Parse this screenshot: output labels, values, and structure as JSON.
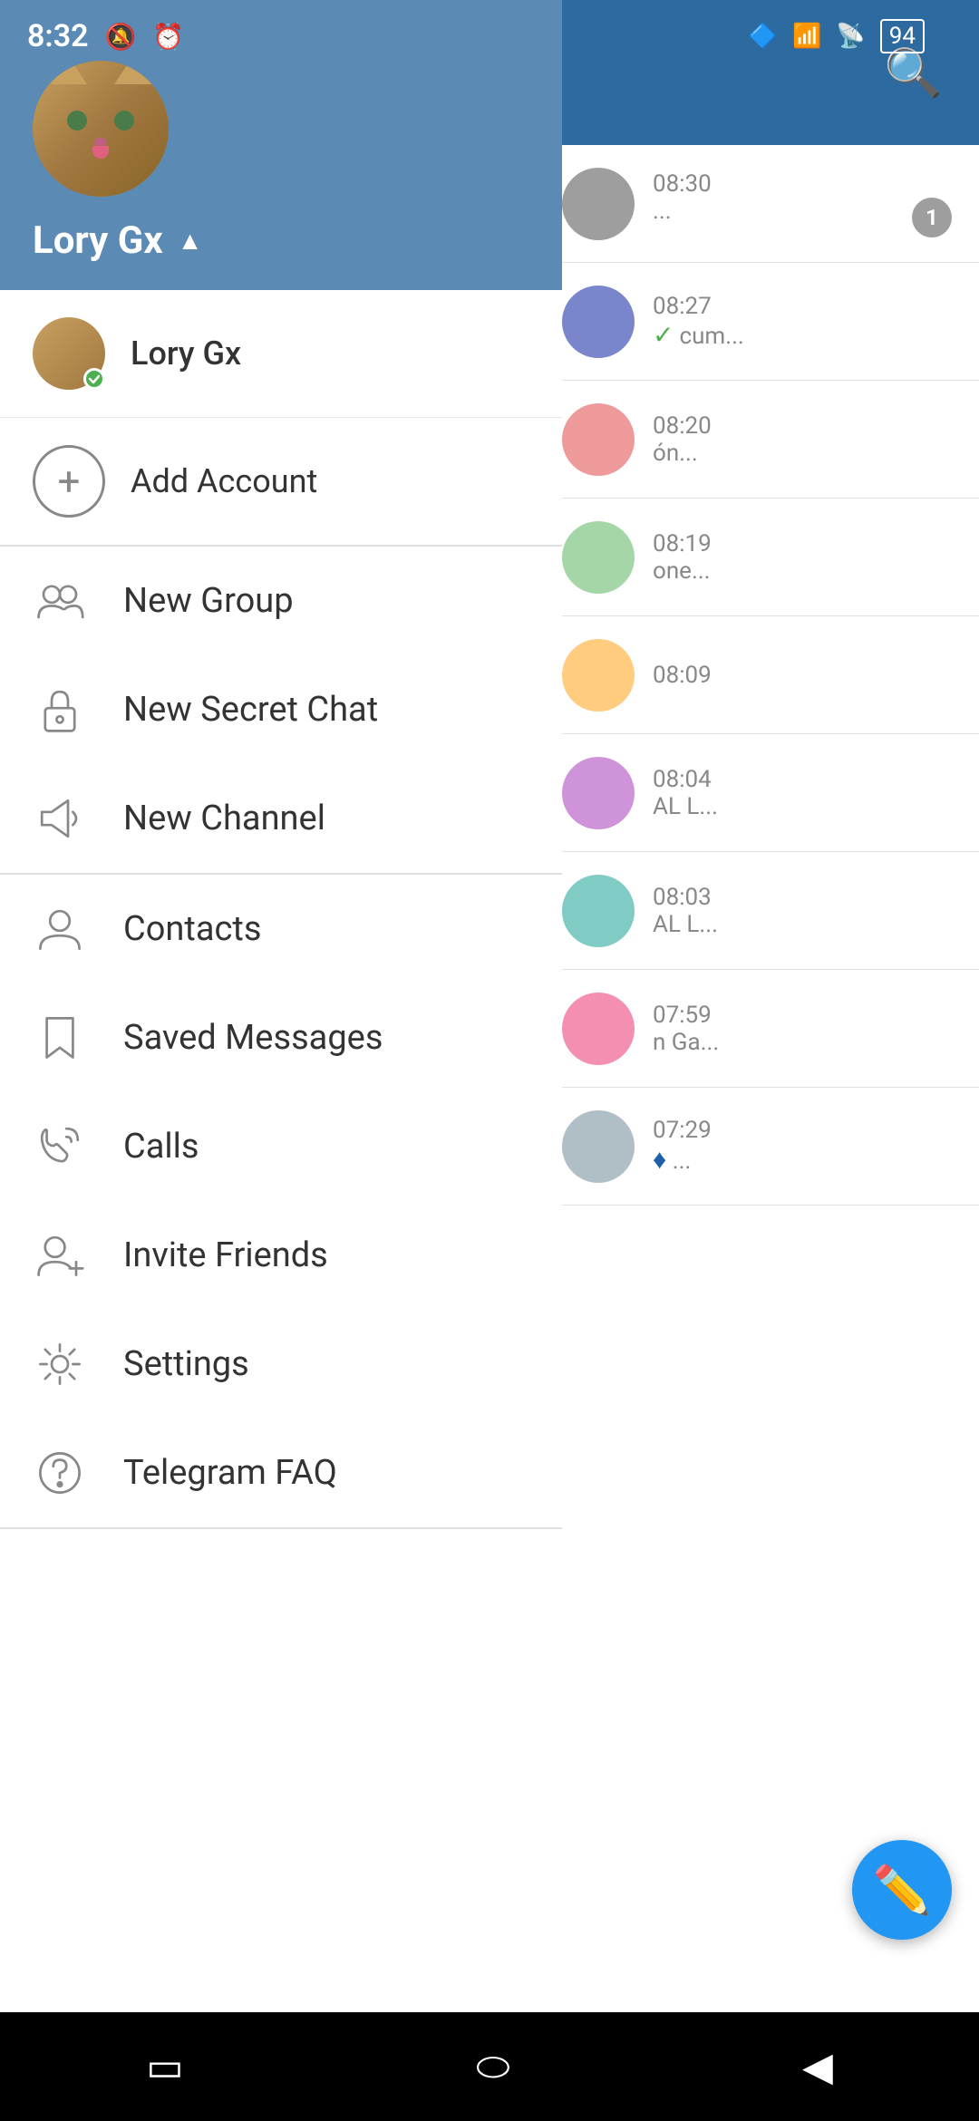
{
  "status_bar": {
    "time": "8:32",
    "battery": "94"
  },
  "sidebar": {
    "username": "Lory Gx",
    "account": {
      "name": "Lory Gx",
      "online": true
    },
    "add_account_label": "Add Account",
    "menu_sections": [
      {
        "items": [
          {
            "id": "new-group",
            "label": "New Group",
            "icon": "group-icon"
          },
          {
            "id": "new-secret-chat",
            "label": "New Secret Chat",
            "icon": "lock-icon"
          },
          {
            "id": "new-channel",
            "label": "New Channel",
            "icon": "megaphone-icon"
          }
        ]
      },
      {
        "items": [
          {
            "id": "contacts",
            "label": "Contacts",
            "icon": "person-icon"
          },
          {
            "id": "saved-messages",
            "label": "Saved Messages",
            "icon": "bookmark-icon"
          },
          {
            "id": "calls",
            "label": "Calls",
            "icon": "phone-icon"
          },
          {
            "id": "invite-friends",
            "label": "Invite Friends",
            "icon": "person-add-icon"
          },
          {
            "id": "settings",
            "label": "Settings",
            "icon": "gear-icon"
          },
          {
            "id": "telegram-faq",
            "label": "Telegram FAQ",
            "icon": "help-icon"
          }
        ]
      }
    ]
  },
  "right_panel": {
    "chat_items": [
      {
        "time": "08:30",
        "preview": "...",
        "badge": "1"
      },
      {
        "time": "08:27",
        "preview": "cum...",
        "check": true
      },
      {
        "time": "08:20",
        "preview": "ón..."
      },
      {
        "time": "08:19",
        "preview": "one..."
      },
      {
        "time": "08:09",
        "preview": ""
      },
      {
        "time": "08:04",
        "preview": "AL L..."
      },
      {
        "time": "08:03",
        "preview": "AL L..."
      },
      {
        "time": "07:59",
        "preview": "n Ga..."
      },
      {
        "time": "07:29",
        "preview": "♦ ..."
      }
    ]
  },
  "nav_bar": {
    "back_label": "◀",
    "home_label": "○",
    "recents_label": "□"
  }
}
